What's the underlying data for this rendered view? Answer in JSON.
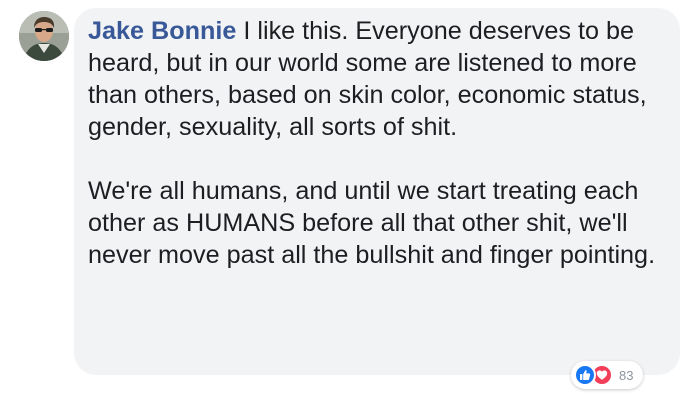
{
  "comment": {
    "author": "Jake Bonnie",
    "paragraph1": "I like this. Everyone deserves to be heard, but in our world some are listened to more than others, based on skin color, economic status, gender, sexuality, all sorts of shit.",
    "paragraph2": "We're all humans, and until we start treating each other as HUMANS before all that other shit, we'll never move past all the bullshit and finger pointing."
  },
  "reactions": {
    "icons": [
      "like-icon",
      "love-icon"
    ],
    "count": "83",
    "colors": {
      "like": "#1877f2",
      "love": "#f33e58"
    }
  },
  "colors": {
    "author_name": "#385898",
    "bubble_bg": "#f2f3f5",
    "text": "#1c1e21"
  }
}
